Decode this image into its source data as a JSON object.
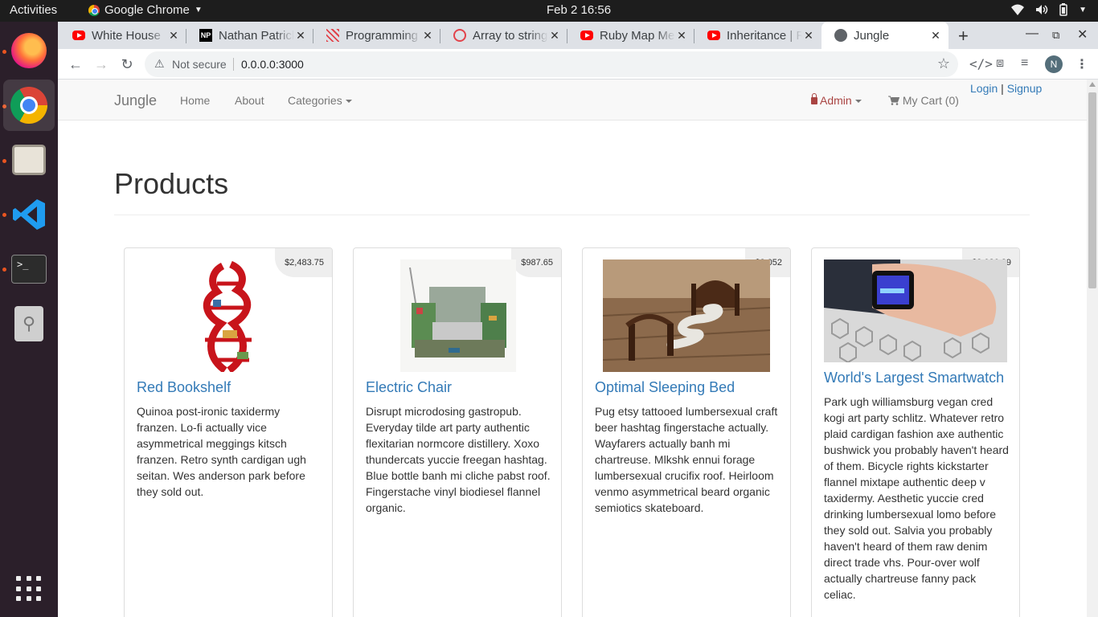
{
  "os": {
    "activities": "Activities",
    "app_name": "Google Chrome",
    "clock": "Feb 2  16:56",
    "dock": [
      "firefox-icon",
      "chrome-icon",
      "files-icon",
      "vscode-icon",
      "terminal-icon",
      "usb-drive-icon",
      "show-apps-icon"
    ]
  },
  "browser": {
    "tabs": [
      {
        "label": "White House",
        "favicon": "youtube-icon"
      },
      {
        "label": "Nathan Patrick",
        "favicon": "np-icon"
      },
      {
        "label": "Programming",
        "favicon": "stripes-icon"
      },
      {
        "label": "Array to string",
        "favicon": "ring-icon"
      },
      {
        "label": "Ruby Map Me",
        "favicon": "youtube-icon"
      },
      {
        "label": "Inheritance | R",
        "favicon": "youtube-icon"
      },
      {
        "label": "Jungle",
        "favicon": "globe-icon"
      }
    ],
    "security": "Not secure",
    "url": "0.0.0.0:3000",
    "profile_initial": "N"
  },
  "site": {
    "brand": "Jungle",
    "nav": {
      "home": "Home",
      "about": "About",
      "categories": "Categories"
    },
    "admin": "Admin",
    "cart": "My Cart (0)",
    "login": "Login",
    "separator": "|",
    "signup": "Signup"
  },
  "page": {
    "title": "Products",
    "products": [
      {
        "name": "Red Bookshelf",
        "price": "$2,483.75",
        "description": "Quinoa post-ironic taxidermy franzen. Lo-fi actually vice asymmetrical meggings kitsch franzen. Retro synth cardigan ugh seitan. Wes anderson park before they sold out."
      },
      {
        "name": "Electric Chair",
        "price": "$987.65",
        "description": "Disrupt microdosing gastropub. Everyday tilde art party authentic flexitarian normcore distillery. Xoxo thundercats yuccie freegan hashtag. Blue bottle banh mi cliche pabst roof. Fingerstache vinyl biodiesel flannel organic."
      },
      {
        "name": "Optimal Sleeping Bed",
        "price": "$3,052",
        "description": "Pug etsy tattooed lumbersexual craft beer hashtag fingerstache actually. Wayfarers actually banh mi chartreuse. Mlkshk ennui forage lumbersexual crucifix roof. Heirloom venmo asymmetrical beard organic semiotics skateboard."
      },
      {
        "name": "World's Largest Smartwatch",
        "price": "$2,026.29",
        "description": "Park ugh williamsburg vegan cred kogi art party schlitz. Whatever retro plaid cardigan fashion axe authentic bushwick you probably haven't heard of them. Bicycle rights kickstarter flannel mixtape authentic deep v taxidermy. Aesthetic yuccie cred drinking lumbersexual lomo before they sold out. Salvia you probably haven't heard of them raw denim direct trade vhs. Pour-over wolf actually chartreuse fanny pack celiac."
      }
    ]
  },
  "colors": {
    "link": "#337ab7",
    "admin": "#a94442",
    "dock": "#2b1f2a",
    "accent_dot": "#e95420"
  }
}
